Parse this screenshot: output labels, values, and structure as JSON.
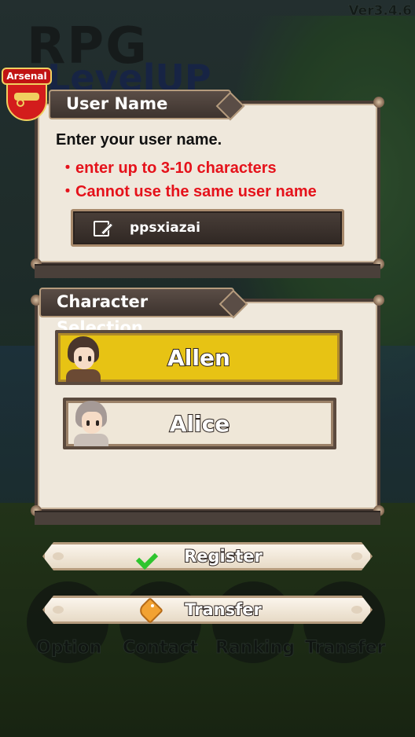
{
  "version": "Ver3.4.6",
  "background": {
    "logo_line1": "RPG",
    "logo_line2": "LevelUP",
    "menu": [
      "Option",
      "Contact",
      "Ranking",
      "Transfer"
    ]
  },
  "badge": {
    "text": "Arsenal",
    "icon": "arsenal-crest-icon"
  },
  "user_name_panel": {
    "header": "User Name",
    "instruction": "Enter your user name.",
    "rules": [
      "・enter up to 3-10 characters",
      "・Cannot use the same user name"
    ],
    "input": {
      "value": "ppsxiazai",
      "icon": "edit-icon"
    }
  },
  "character_panel": {
    "header": "Character Selection",
    "characters": [
      {
        "name": "Allen",
        "selected": true
      },
      {
        "name": "Alice",
        "selected": false
      }
    ]
  },
  "buttons": {
    "register": {
      "label": "Register",
      "icon": "check-icon"
    },
    "transfer": {
      "label": "Transfer",
      "icon": "tag-icon"
    }
  },
  "colors": {
    "rule_text": "#e5121b",
    "selected_character": "#e7c314",
    "panel_bg": "#efe8dc"
  }
}
